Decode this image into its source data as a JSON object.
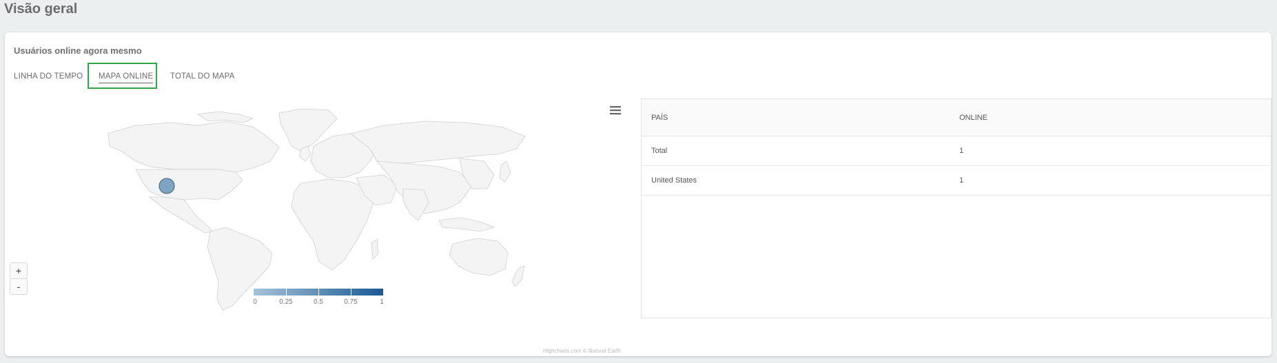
{
  "page": {
    "title": "Visão geral"
  },
  "card": {
    "title": "Usuários online agora mesmo",
    "tabs": [
      {
        "label": "LINHA DO TEMPO",
        "active": false
      },
      {
        "label": "MAPA ONLINE",
        "active": true
      },
      {
        "label": "TOTAL DO MAPA",
        "active": false
      }
    ]
  },
  "map": {
    "zoom_in": "+",
    "zoom_out": "-",
    "menu_icon": "hamburger-menu-icon",
    "legend": {
      "min": 0,
      "max": 1,
      "ticks": [
        "0",
        "0.25",
        "0.5",
        "0.75",
        "1"
      ]
    },
    "credits": "Highcharts.com © Natural Earth",
    "bubble": {
      "country": "United States",
      "value": 1
    },
    "colors": {
      "land": "#f4f4f4",
      "border": "#cfcfcf",
      "bubble": "#7ea4c4"
    }
  },
  "table": {
    "headers": [
      "PAÍS",
      "ONLINE"
    ],
    "rows": [
      [
        "Total",
        "1"
      ],
      [
        "United States",
        "1"
      ]
    ]
  }
}
